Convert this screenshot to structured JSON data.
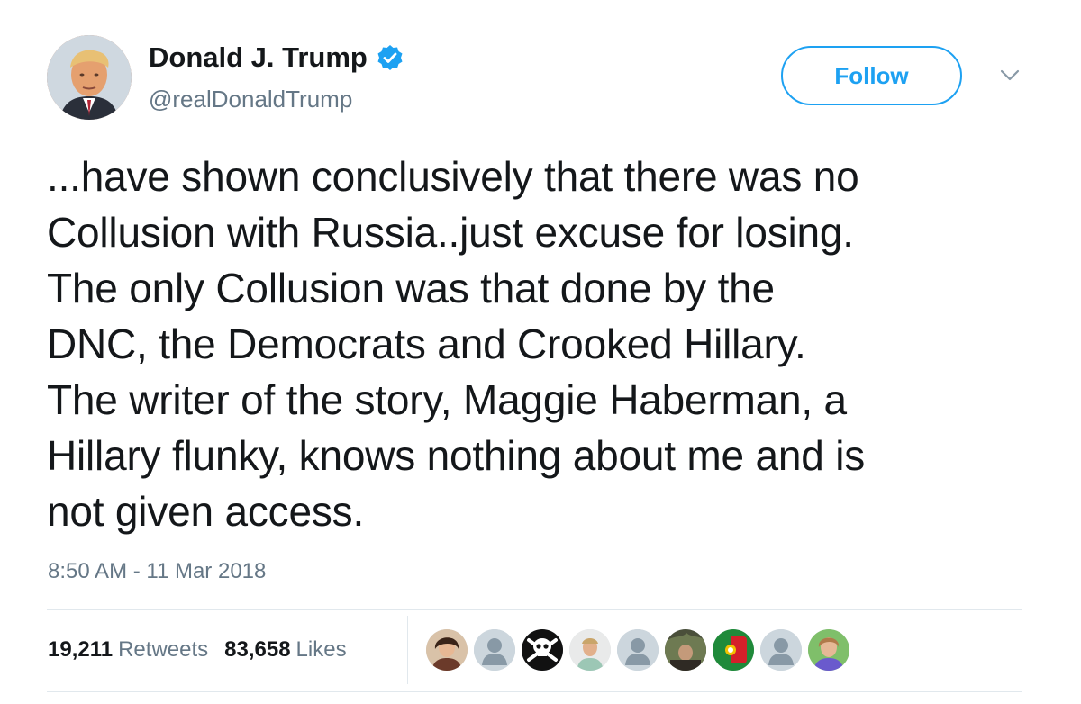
{
  "author": {
    "display_name": "Donald J. Trump",
    "handle": "@realDonaldTrump",
    "verified": true,
    "avatar_icon": "profile-photo"
  },
  "actions": {
    "follow_label": "Follow",
    "menu_icon": "chevron-down-icon"
  },
  "tweet": {
    "text": "...have shown conclusively that there was no\nCollusion with Russia..just excuse for losing.\nThe only Collusion was that done by the\nDNC, the Democrats and Crooked Hillary.\nThe writer of the story, Maggie Haberman, a\nHillary flunky, knows nothing about me and is\nnot given access.",
    "timestamp": "8:50 AM - 11 Mar 2018"
  },
  "stats": {
    "retweets_count": "19,211",
    "retweets_label": "Retweets",
    "likes_count": "83,658",
    "likes_label": "Likes"
  },
  "likers": [
    {
      "icon": "photo-avatar"
    },
    {
      "icon": "default-avatar"
    },
    {
      "icon": "skull-crossbones-avatar"
    },
    {
      "icon": "photo-avatar"
    },
    {
      "icon": "default-avatar"
    },
    {
      "icon": "photo-avatar"
    },
    {
      "icon": "flag-avatar"
    },
    {
      "icon": "default-avatar"
    },
    {
      "icon": "photo-avatar"
    }
  ],
  "colors": {
    "accent": "#1da1f2",
    "text_primary": "#14171a",
    "text_secondary": "#657786",
    "divider": "#e1e8ed"
  }
}
